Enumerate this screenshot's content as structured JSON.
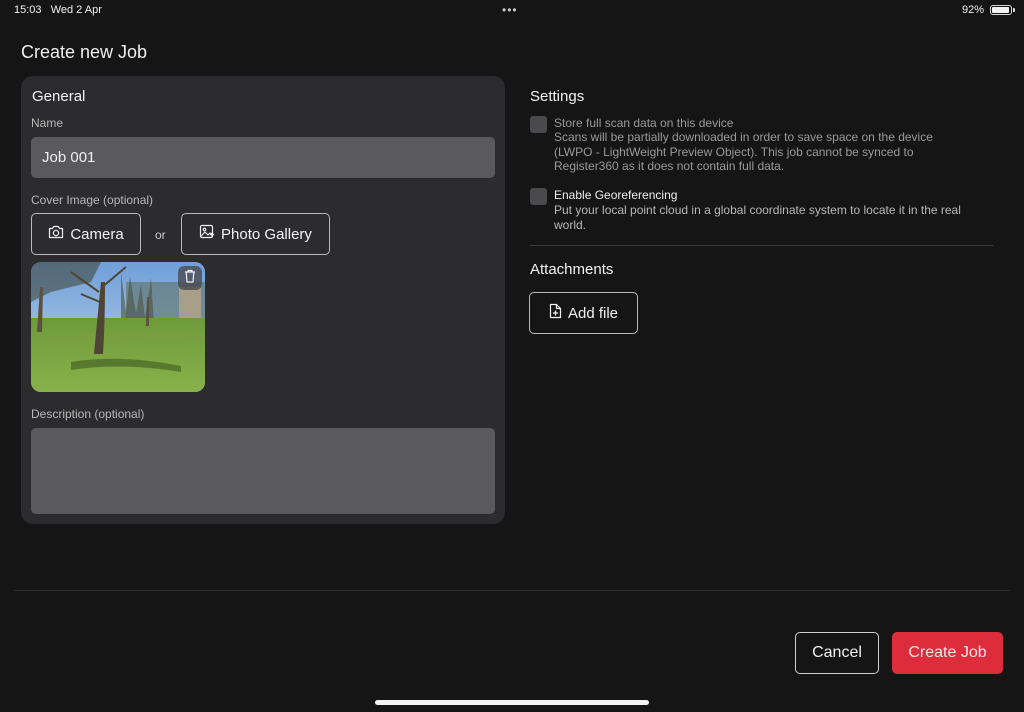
{
  "status_bar": {
    "time": "15:03",
    "date": "Wed 2 Apr",
    "dots": "•••",
    "battery_percent": "92%",
    "battery_level": 0.92
  },
  "page": {
    "title": "Create new Job"
  },
  "general": {
    "title": "General",
    "name_label": "Name",
    "name_value": "Job 001",
    "cover_label": "Cover Image (optional)",
    "camera_label": "Camera",
    "or_text": "or",
    "gallery_label": "Photo Gallery",
    "description_label": "Description (optional)",
    "description_value": ""
  },
  "settings": {
    "title": "Settings",
    "store_full": {
      "title": "Store full scan data on this device",
      "description": "Scans will be partially downloaded in order to save space on the device (LWPO - LightWeight Preview Object). This job cannot be synced to Register360 as it does not contain full data.",
      "checked": false
    },
    "georef": {
      "title": "Enable Georeferencing",
      "description": "Put your local point cloud in a global coordinate system to locate it in the real world.",
      "checked": false
    }
  },
  "attachments": {
    "title": "Attachments",
    "add_file_label": "Add file"
  },
  "footer": {
    "cancel_label": "Cancel",
    "create_label": "Create Job"
  },
  "colors": {
    "background": "#151516",
    "card": "#2c2c2e",
    "input": "#5a5a5c",
    "accent": "#dd2c3c"
  },
  "icons": {
    "camera": "camera-icon",
    "gallery": "photo-gallery-icon",
    "delete": "trash-icon",
    "add_file": "add-file-icon"
  }
}
